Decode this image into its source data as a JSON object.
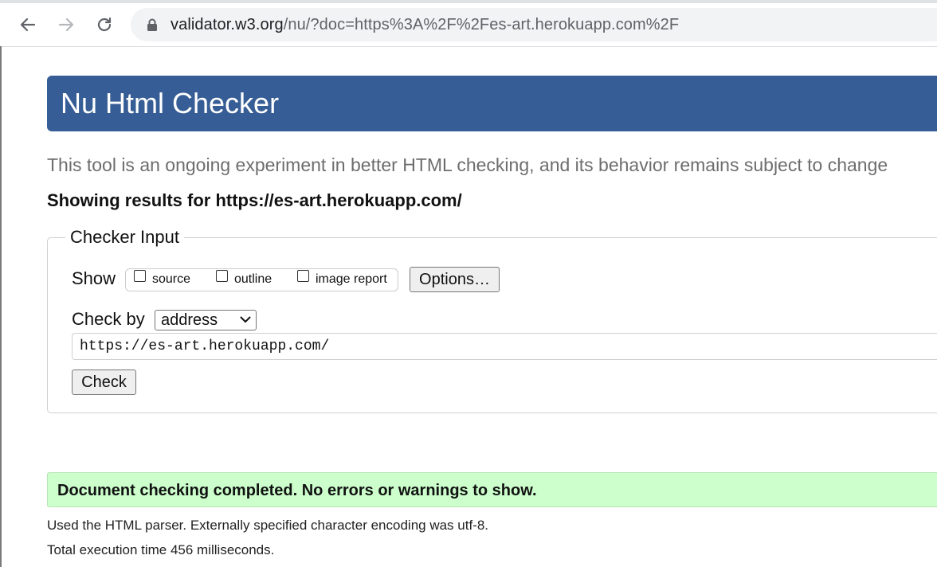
{
  "browser": {
    "url_host": "validator.w3.org",
    "url_rest": "/nu/?doc=https%3A%2F%2Fes-art.herokuapp.com%2F",
    "back_icon": "back-arrow-icon",
    "forward_icon": "forward-arrow-icon",
    "reload_icon": "reload-icon",
    "lock_icon": "lock-icon"
  },
  "header": {
    "title": "Nu Html Checker"
  },
  "subtitle": "This tool is an ongoing experiment in better HTML checking, and its behavior remains subject to change",
  "showing_results": "Showing results for https://es-art.herokuapp.com/",
  "checker_input": {
    "legend": "Checker Input",
    "show_label": "Show",
    "options": [
      {
        "label": "source",
        "checked": false
      },
      {
        "label": "outline",
        "checked": false
      },
      {
        "label": "image report",
        "checked": false
      }
    ],
    "options_button": "Options…",
    "check_by_label": "Check by",
    "check_by_value": "address",
    "url_value": "https://es-art.herokuapp.com/",
    "check_button": "Check"
  },
  "result": {
    "message": "Document checking completed. No errors or warnings to show.",
    "parser_info": "Used the HTML parser. Externally specified character encoding was utf-8.",
    "execution_time": "Total execution time 456 milliseconds."
  },
  "colors": {
    "banner": "#365d95",
    "success_bg": "#ccffcc"
  }
}
